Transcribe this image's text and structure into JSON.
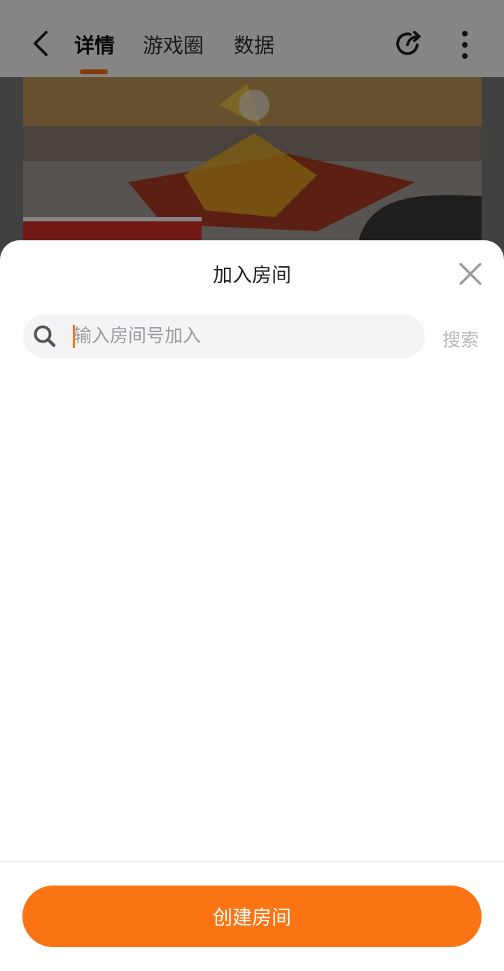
{
  "colors": {
    "accent": "#fb7414",
    "background_dim": "#7d7d7d",
    "tab_text": "#333333"
  },
  "header": {
    "back_icon": "chevron-left-icon",
    "tabs": [
      {
        "label": "详情",
        "active": true
      },
      {
        "label": "游戏圈",
        "active": false
      },
      {
        "label": "数据",
        "active": false
      }
    ],
    "share_icon": "share-icon",
    "more_icon": "more-vertical-icon"
  },
  "banner": {
    "image": "game-banner-image"
  },
  "sheet": {
    "title": "加入房间",
    "close_icon": "close-icon",
    "search": {
      "icon": "search-icon",
      "placeholder": "输入房间号加入",
      "value": "",
      "button_label": "搜索"
    },
    "create_button_label": "创建房间"
  }
}
